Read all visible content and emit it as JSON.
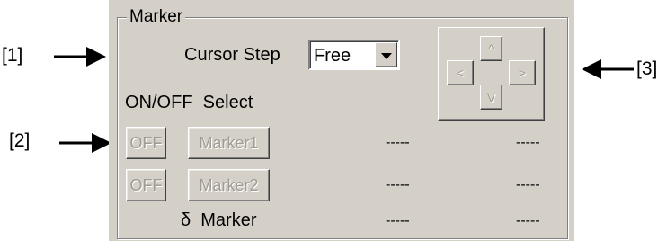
{
  "callouts": [
    "[1]",
    "[2]",
    "[3]"
  ],
  "group_title": "Marker",
  "cursor_step": {
    "label": "Cursor Step",
    "value": "Free"
  },
  "onoff_select_label": "ON/OFF  Select",
  "rows": [
    {
      "toggle": "OFF",
      "marker": "Marker1",
      "value1": "-----",
      "value2": "-----"
    },
    {
      "toggle": "OFF",
      "marker": "Marker2",
      "value1": "-----",
      "value2": "-----"
    }
  ],
  "delta": {
    "label": "δ  Marker",
    "value1": "-----",
    "value2": "-----"
  },
  "dpad": {
    "up": "^",
    "left": "<",
    "right": ">",
    "down": "V"
  },
  "colors": {
    "panel": "#d4d0c8",
    "disabled_text": "#a09c94"
  }
}
